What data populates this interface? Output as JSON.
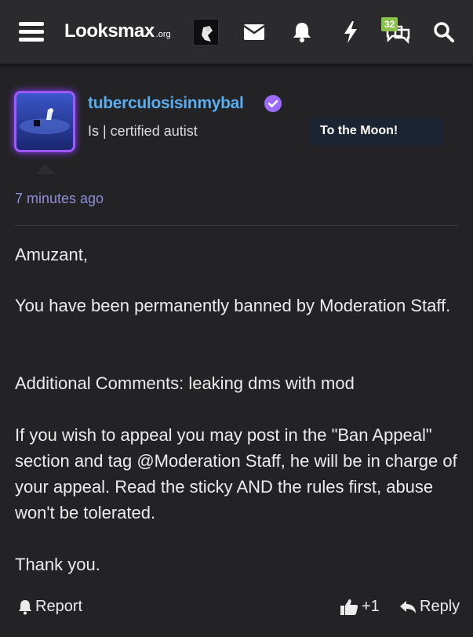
{
  "header": {
    "logo_main": "Looksmax",
    "logo_tld": ".org",
    "alerts_badge": "32",
    "icons": [
      "menu-icon",
      "envelope-icon",
      "bell-icon",
      "bolt-icon",
      "chat-icon",
      "search-icon"
    ]
  },
  "post": {
    "username": "tuberculosisinmybal",
    "user_title": "Is | certified autist",
    "user_tag": "To the Moon!",
    "timestamp": "7 minutes ago",
    "paragraphs": [
      "Amuzant,",
      "You have been permanently banned by Moderation Staff.",
      "Additional Comments: leaking dms with mod",
      "If you wish to appeal you may post in the \"Ban Appeal\" section and tag @Moderation Staff, he will be in charge of your appeal. Read the sticky AND the rules first, abuse won't be tolerated.",
      "Thank you."
    ]
  },
  "actions": {
    "report_label": "Report",
    "like_label": "+1",
    "reply_label": "Reply"
  },
  "colors": {
    "background": "#232325",
    "topbar": "#2b2b2d",
    "username": "#5aaef0",
    "verified": "#9b6bff",
    "timestamp": "#8e8ed8",
    "badge": "#8bc34a"
  }
}
